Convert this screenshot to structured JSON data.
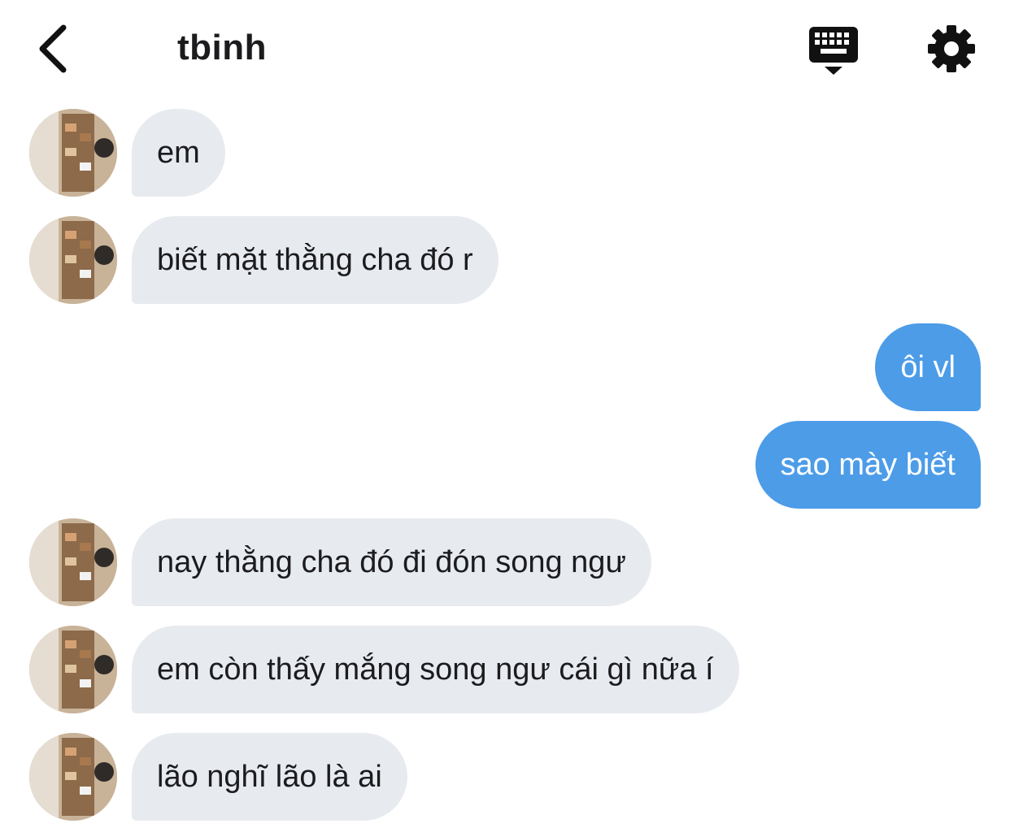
{
  "header": {
    "title": "tbinh",
    "back_icon": "chevron-left-icon",
    "keyboard_icon": "keyboard-icon",
    "settings_icon": "gear-icon"
  },
  "colors": {
    "incoming_bubble": "#e7eaef",
    "outgoing_bubble": "#4c9ce8",
    "incoming_text": "#1c1c1e",
    "outgoing_text": "#ffffff"
  },
  "messages": [
    {
      "direction": "in",
      "text": "em"
    },
    {
      "direction": "in",
      "text": "biết mặt thằng cha đó r"
    },
    {
      "direction": "out",
      "text": "ôi vl"
    },
    {
      "direction": "out",
      "text": "sao mày biết"
    },
    {
      "direction": "in",
      "text": "nay thằng cha đó đi đón song ngư"
    },
    {
      "direction": "in",
      "text": "em còn thấy mắng song ngư cái gì nữa í"
    },
    {
      "direction": "in",
      "text": "lão nghĩ lão là ai"
    }
  ]
}
